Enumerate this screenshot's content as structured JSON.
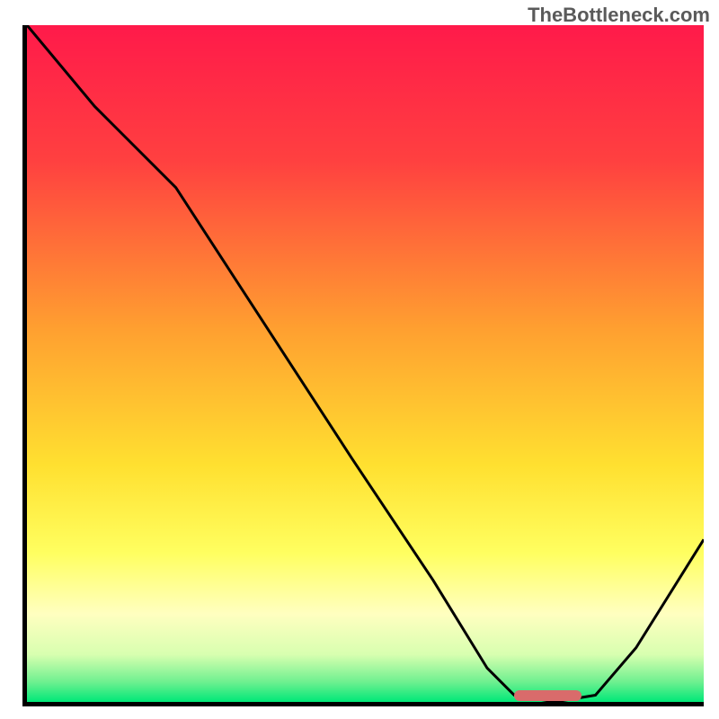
{
  "watermark": "TheBottleneck.com",
  "chart_data": {
    "type": "line",
    "title": "",
    "xlabel": "",
    "ylabel": "",
    "xlim": [
      0,
      100
    ],
    "ylim": [
      0,
      100
    ],
    "gradient_stops": [
      {
        "pos": 0,
        "color": "#ff1a4a"
      },
      {
        "pos": 20,
        "color": "#ff4040"
      },
      {
        "pos": 45,
        "color": "#ffa030"
      },
      {
        "pos": 65,
        "color": "#ffe030"
      },
      {
        "pos": 78,
        "color": "#ffff60"
      },
      {
        "pos": 87,
        "color": "#ffffc0"
      },
      {
        "pos": 93,
        "color": "#d8ffb0"
      },
      {
        "pos": 97,
        "color": "#70f090"
      },
      {
        "pos": 100,
        "color": "#00e878"
      }
    ],
    "series": [
      {
        "name": "curve",
        "x": [
          0,
          10,
          22,
          35,
          48,
          60,
          68,
          72,
          78,
          84,
          90,
          100
        ],
        "y": [
          100,
          88,
          76,
          56,
          36,
          18,
          5,
          1,
          0,
          1,
          8,
          24
        ]
      }
    ],
    "marker": {
      "x_start": 72,
      "x_end": 82,
      "y": 0.6
    }
  }
}
